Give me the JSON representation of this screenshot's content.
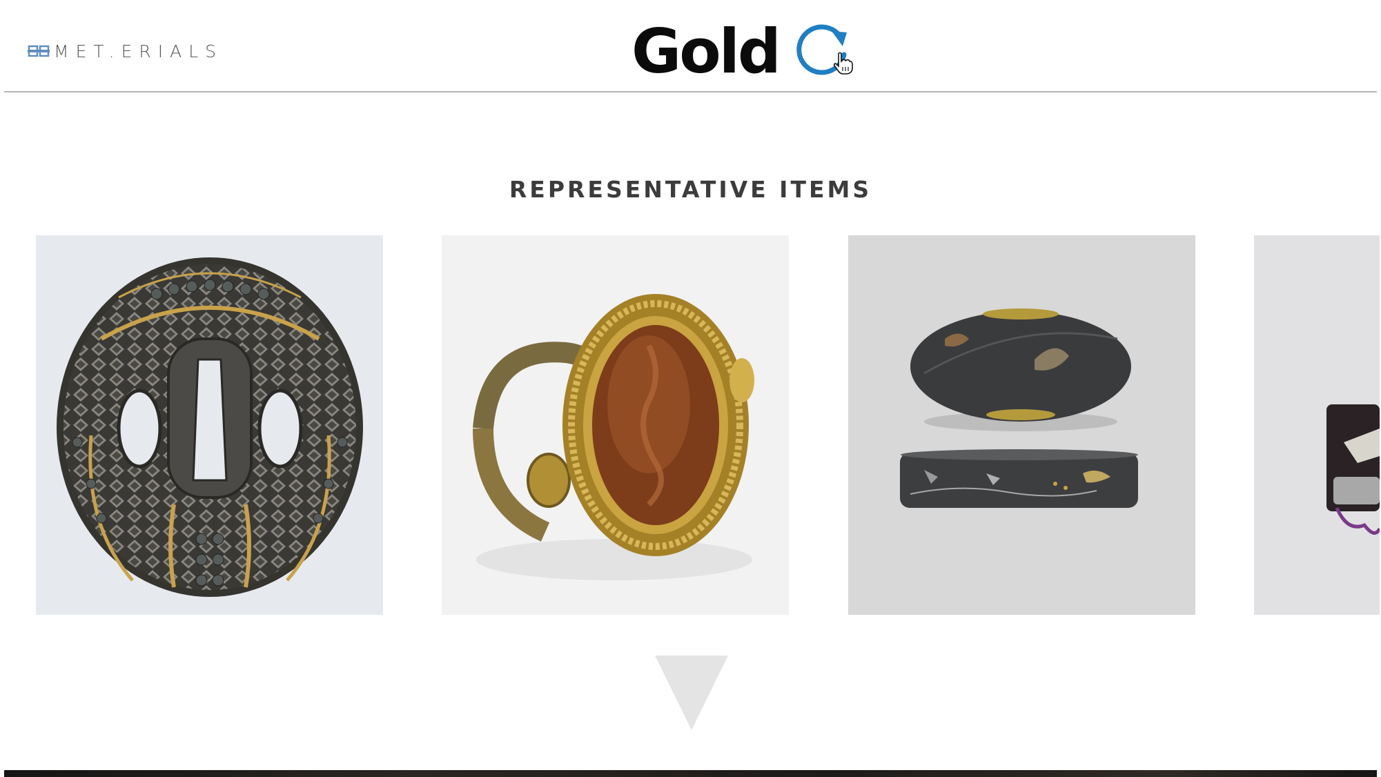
{
  "header": {
    "logo_text": "MET.ERIALS",
    "logo_icon": "chain-link-icon",
    "title": "Gold",
    "refresh_icon": "refresh-icon",
    "accent_color": "#1f7fc4"
  },
  "section": {
    "title": "REPRESENTATIVE ITEMS"
  },
  "items": [
    {
      "icon": "sword-guard-tsuba-image"
    },
    {
      "icon": "gold-intaglio-ring-image"
    },
    {
      "icon": "sword-fittings-fuchi-kashira-image"
    },
    {
      "icon": "lacquer-inro-image-partial"
    }
  ],
  "scroll": {
    "down_icon": "down-triangle-icon"
  }
}
